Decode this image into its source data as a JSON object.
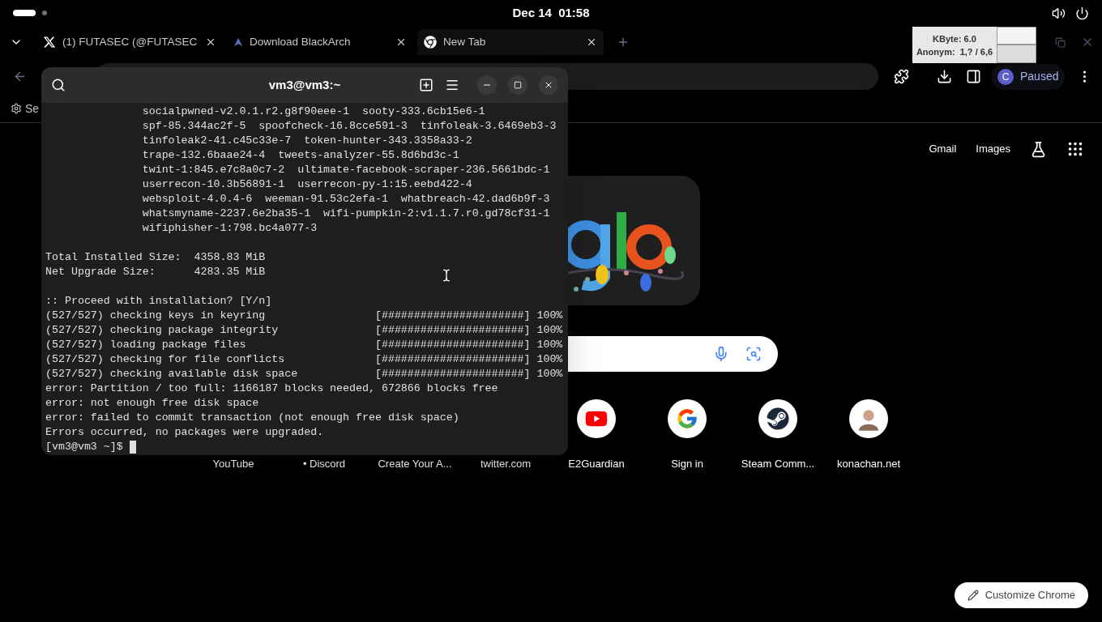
{
  "system_bar": {
    "clock": "Dec 14  01:58"
  },
  "browser": {
    "tabs": [
      {
        "title": "(1) FUTASEC (@FUTASEC",
        "kind": "x",
        "selected": false
      },
      {
        "title": "Download BlackArch",
        "kind": "triangle",
        "selected": false
      },
      {
        "title": "New Tab",
        "kind": "chrome",
        "selected": true
      }
    ],
    "profile": {
      "initial": "C",
      "status": "Paused"
    },
    "bookmark": "Se",
    "header_links": [
      "Gmail",
      "Images"
    ],
    "shortcuts": [
      {
        "label": "YouTube"
      },
      {
        "label": "• Discord"
      },
      {
        "label": "Create Your A..."
      },
      {
        "label": "twitter.com"
      },
      {
        "label": "E2Guardian",
        "kind": "play"
      },
      {
        "label": "Sign in",
        "kind": "g"
      },
      {
        "label": "Steam Comm...",
        "kind": "steam"
      },
      {
        "label": "konachan.net",
        "kind": "avatar"
      }
    ],
    "customize": "Customize Chrome"
  },
  "monitor": {
    "line_1": "KByte: 6.0",
    "line_2": "Anonym:  1,? / 6,6"
  },
  "terminal": {
    "title": "vm3@vm3:~",
    "lines": [
      {
        "kind": "package",
        "text": "socialpwned-v2.0.1.r2.g8f90eee-1  sooty-333.6cb15e6-1"
      },
      {
        "kind": "package",
        "text": "spf-85.344ac2f-5  spoofcheck-16.8cce591-3  tinfoleak-3.6469eb3-3"
      },
      {
        "kind": "package",
        "text": "tinfoleak2-41.c45c33e-7  token-hunter-343.3358a33-2"
      },
      {
        "kind": "package",
        "text": "trape-132.6baae24-4  tweets-analyzer-55.8d6bd3c-1"
      },
      {
        "kind": "package",
        "text": "twint-1:845.e7c8a0c7-2  ultimate-facebook-scraper-236.5661bdc-1"
      },
      {
        "kind": "package",
        "text": "userrecon-10.3b56891-1  userrecon-py-1:15.eebd422-4"
      },
      {
        "kind": "package",
        "text": "websploit-4.0.4-6  weeman-91.53c2efa-1  whatbreach-42.dad6b9f-3"
      },
      {
        "kind": "package",
        "text": "whatsmyname-2237.6e2ba35-1  wifi-pumpkin-2:v1.1.7.r0.gd78cf31-1"
      },
      {
        "kind": "package",
        "text": "wifiphisher-1:798.bc4a077-3"
      },
      {
        "kind": "blank"
      },
      {
        "kind": "text",
        "text": "Total Installed Size:  4358.83 MiB"
      },
      {
        "kind": "text",
        "text": "Net Upgrade Size:      4283.35 MiB"
      },
      {
        "kind": "blank"
      },
      {
        "kind": "text",
        "text": ":: Proceed with installation? [Y/n]"
      },
      {
        "kind": "progress",
        "text": "(527/527) checking keys in keyring",
        "bar": "[######################]",
        "percent": "100%"
      },
      {
        "kind": "progress",
        "text": "(527/527) checking package integrity",
        "bar": "[######################]",
        "percent": "100%"
      },
      {
        "kind": "progress",
        "text": "(527/527) loading package files",
        "bar": "[######################]",
        "percent": "100%"
      },
      {
        "kind": "progress",
        "text": "(527/527) checking for file conflicts",
        "bar": "[######################]",
        "percent": "100%"
      },
      {
        "kind": "progress",
        "text": "(527/527) checking available disk space",
        "bar": "[######################]",
        "percent": "100%"
      },
      {
        "kind": "text",
        "text": "error: Partition / too full: 1166187 blocks needed, 672866 blocks free"
      },
      {
        "kind": "text",
        "text": "error: not enough free disk space"
      },
      {
        "kind": "text",
        "text": "error: failed to commit transaction (not enough free disk space)"
      },
      {
        "kind": "text",
        "text": "Errors occurred, no packages were upgraded."
      },
      {
        "kind": "prompt",
        "text": "[vm3@vm3 ~]$"
      }
    ]
  }
}
